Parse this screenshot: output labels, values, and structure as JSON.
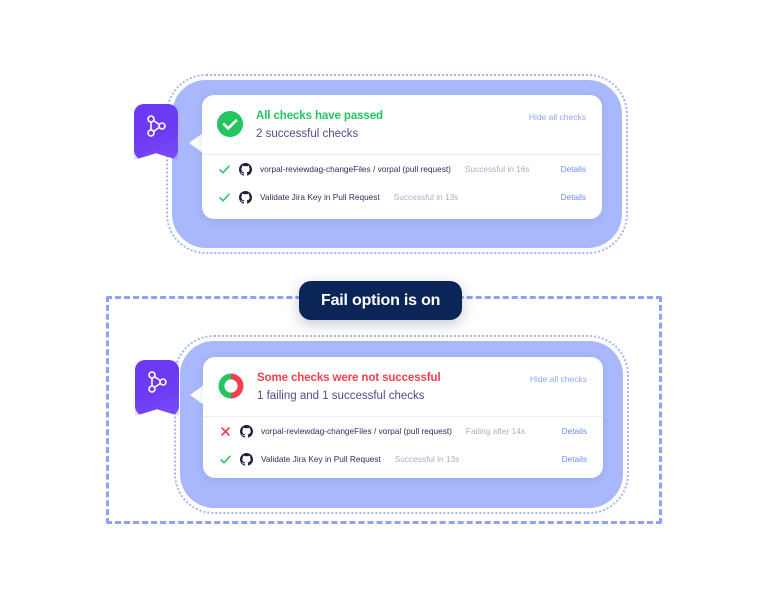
{
  "badge": {
    "label": "Fail option is on",
    "bg_color": "#0b2559",
    "text_color": "#ffffff"
  },
  "colors": {
    "panel_blue": "#a9b8fc",
    "dashed_border": "#8da2fb",
    "purple_badge": "#6c38f5",
    "success_green": "#22c55e",
    "fail_red": "#f43f4e",
    "link_blue": "#6d8cf2",
    "hide_link_blue": "#93a6f7",
    "muted_text": "#a9afc9",
    "name_text": "#2d2f5e",
    "subtitle_text": "#4c4f8c"
  },
  "panels": [
    {
      "id": "passed-panel",
      "side_icon": "git-branch-icon",
      "header": {
        "status_icon": "check-circle-filled-icon",
        "title": "All checks have passed",
        "subtitle": "2 successful checks",
        "hide_link": "Hide all checks"
      },
      "rows": [
        {
          "mark": "check-icon",
          "provider_icon": "github-icon",
          "name": "vorpal-reviewdag-changeFiles / vorpal (pull request)",
          "status": "Successful in 16s",
          "details": "Details"
        },
        {
          "mark": "check-icon",
          "provider_icon": "github-icon",
          "name": "Validate Jira Key in Pull Request",
          "status": "Successful in 13s",
          "details": "Details"
        }
      ]
    },
    {
      "id": "failed-panel",
      "side_icon": "git-branch-icon",
      "header": {
        "status_icon": "donut-half-red-green-icon",
        "title": "Some checks were not successful",
        "subtitle": "1 failing and 1 successful checks",
        "hide_link": "Hide all checks"
      },
      "rows": [
        {
          "mark": "cross-icon",
          "provider_icon": "github-icon",
          "name": "vorpal-reviewdag-changeFiles / vorpal (pull request)",
          "status": "Failing after 14s",
          "details": "Details"
        },
        {
          "mark": "check-icon",
          "provider_icon": "github-icon",
          "name": "Validate Jira Key in Pull Request",
          "status": "Successful in 13s",
          "details": "Details"
        }
      ]
    }
  ]
}
